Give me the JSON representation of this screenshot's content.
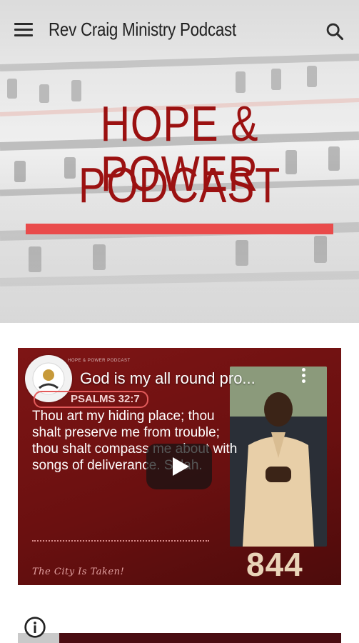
{
  "header": {
    "title": "Rev Craig Ministry Podcast",
    "menu_icon": "hamburger-menu-icon",
    "search_icon": "search-icon"
  },
  "hero": {
    "line1": "HOPE & POWER",
    "line2": "PODCAST",
    "accent_color": "#9b1111",
    "bar_color": "#e94b4b"
  },
  "video": {
    "title": "God is my all round pro...",
    "channel_strip": "HOPE & POWER PODCAST",
    "scripture_ref": "PSALMS 32:7",
    "verse": "Thou art my hiding place; thou shalt preserve me from trouble; thou shalt compass me about with songs of deliverance. Selah.",
    "tagline": "The City Is Taken!",
    "episode_number": "844",
    "play_icon": "play-icon",
    "more_icon": "more-vert-icon"
  },
  "next": {
    "info_icon": "info-icon"
  }
}
